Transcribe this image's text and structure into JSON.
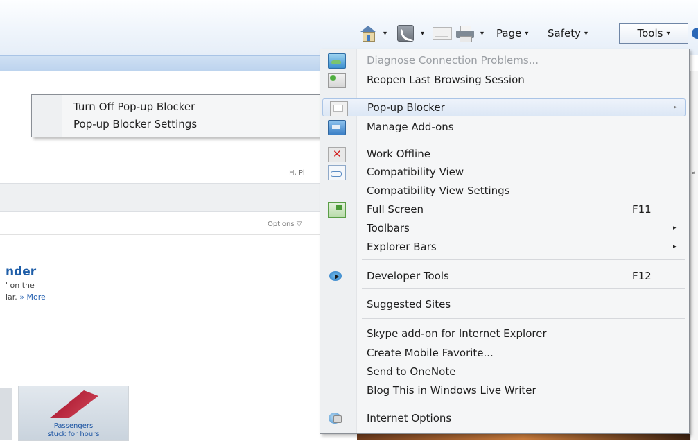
{
  "command_bar": {
    "home_icon": "home-icon",
    "feeds_icon": "feeds-icon",
    "mail_icon": "read-mail-icon",
    "print_icon": "print-icon",
    "page_label": "Page",
    "safety_label": "Safety",
    "tools_label": "Tools",
    "dropdown_glyph": "▾"
  },
  "background_page": {
    "options_label": "Options ▽",
    "fragment_text": "H, Pl",
    "heading": "nder",
    "text_line1": "' on the",
    "text_line2": "iar.",
    "more_link": "» More",
    "thumbnail_caption_line1": "Passengers",
    "thumbnail_caption_line2": "stuck for hours",
    "right_edge_text": "a"
  },
  "tools_menu": {
    "items": [
      {
        "label": "Diagnose Connection Problems...",
        "icon": "diagnose-icon",
        "disabled": true
      },
      {
        "label": "Reopen Last Browsing Session",
        "icon": "reopen-session-icon"
      },
      {
        "label": "Pop-up Blocker",
        "icon": "popup-blocker-icon",
        "submenu": true,
        "highlighted": true
      },
      {
        "label": "Manage Add-ons",
        "icon": "add-ons-icon"
      },
      {
        "label": "Work Offline",
        "icon": "work-offline-icon"
      },
      {
        "label": "Compatibility View",
        "icon": "compatibility-view-icon"
      },
      {
        "label": "Compatibility View Settings"
      },
      {
        "label": "Full Screen",
        "icon": "full-screen-icon",
        "shortcut": "F11"
      },
      {
        "label": "Toolbars",
        "submenu": true
      },
      {
        "label": "Explorer Bars",
        "submenu": true
      },
      {
        "label": "Developer Tools",
        "icon": "developer-tools-icon",
        "shortcut": "F12"
      },
      {
        "label": "Suggested Sites"
      },
      {
        "label": "Skype add-on for Internet Explorer"
      },
      {
        "label": "Create Mobile Favorite..."
      },
      {
        "label": "Send to OneNote"
      },
      {
        "label": "Blog This in Windows Live Writer"
      },
      {
        "label": "Internet Options",
        "icon": "internet-options-icon"
      }
    ],
    "submenu_arrow": "▸"
  },
  "popup_submenu": {
    "items": [
      {
        "label": "Turn Off Pop-up Blocker"
      },
      {
        "label": "Pop-up Blocker Settings"
      }
    ]
  }
}
